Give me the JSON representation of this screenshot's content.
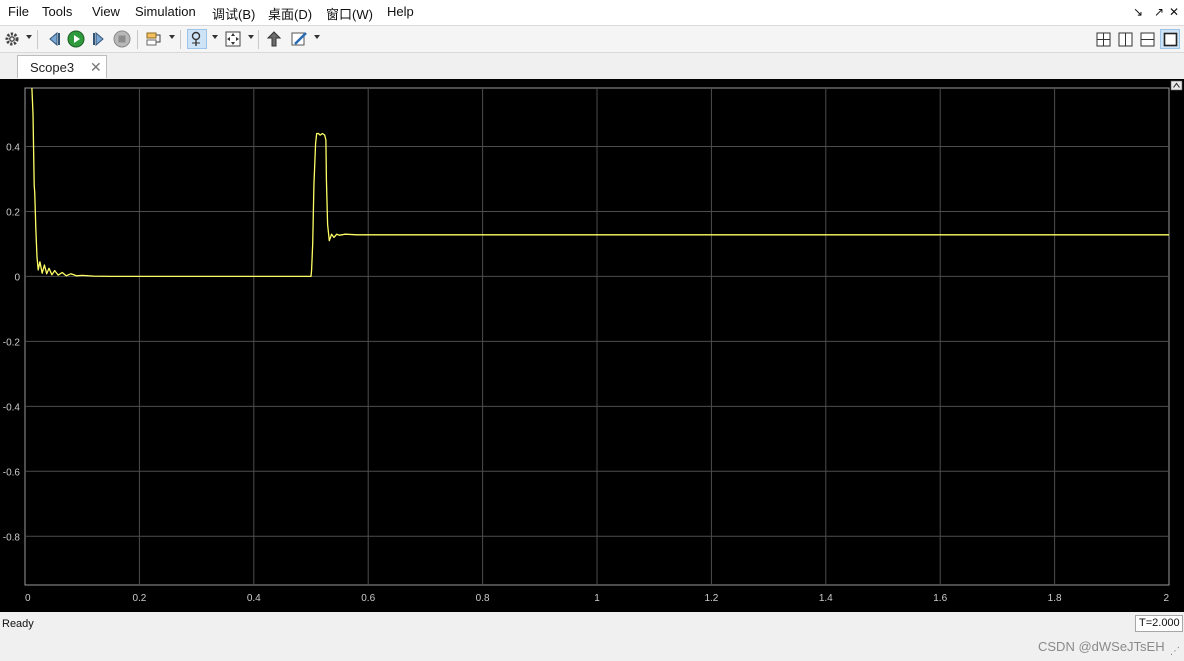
{
  "menubar": {
    "items": [
      "File",
      "Tools",
      "View",
      "Simulation",
      "调试(B)",
      "桌面(D)",
      "窗口(W)",
      "Help"
    ],
    "window_buttons": [
      "↘",
      "↗",
      "✕"
    ]
  },
  "toolbar": {
    "left_icons": [
      "gear-icon",
      "step-back-icon",
      "run-icon",
      "step-forward-icon",
      "stop-icon",
      "signal-select-icon",
      "zoom-icon",
      "autoscale-icon",
      "highlight-block-icon",
      "style-icon"
    ],
    "right_icons": [
      "layout-2x2-icon",
      "layout-2col-icon",
      "layout-2row-icon",
      "layout-single-icon"
    ]
  },
  "tab": {
    "label": "Scope3",
    "close": "✕"
  },
  "status": {
    "text": "Ready",
    "time": "T=2.000"
  },
  "watermark": "CSDN @dWSeJTsEH",
  "colors": {
    "background": "#000000",
    "grid": "#4d4d4d",
    "trace": "#ffff66",
    "tick_text": "#cccccc"
  },
  "chart_data": {
    "type": "line",
    "title": "",
    "xlabel": "",
    "ylabel": "",
    "xlim": [
      0,
      2
    ],
    "ylim": [
      -0.95,
      0.58
    ],
    "xticks": [
      0,
      0.2,
      0.4,
      0.6,
      0.8,
      1,
      1.2,
      1.4,
      1.6,
      1.8,
      2
    ],
    "xtick_labels": [
      "0",
      "0.2",
      "0.4",
      "0.6",
      "0.8",
      "1",
      "1.2",
      "1.4",
      "1.6",
      "1.8",
      "2"
    ],
    "yticks": [
      0.4,
      0.2,
      0,
      -0.2,
      -0.4,
      -0.6,
      -0.8
    ],
    "ytick_labels": [
      "0.4",
      "0.2",
      "0",
      "-0.2",
      "-0.4",
      "-0.6",
      "-0.8"
    ],
    "grid": true,
    "series": [
      {
        "x": [
          0.012,
          0.014,
          0.016,
          0.017,
          0.019,
          0.021,
          0.023,
          0.026,
          0.03,
          0.034,
          0.038,
          0.042,
          0.047,
          0.052,
          0.058,
          0.065,
          0.072,
          0.08,
          0.09,
          0.1,
          0.12,
          0.15,
          0.2,
          0.3,
          0.4,
          0.48,
          0.5,
          0.501,
          0.503,
          0.505,
          0.508,
          0.51,
          0.513,
          0.516,
          0.52,
          0.524,
          0.526,
          0.527,
          0.529,
          0.532,
          0.536,
          0.54,
          0.545,
          0.55,
          0.56,
          0.58,
          0.6,
          0.7,
          0.8,
          0.9,
          1.0,
          1.2,
          1.4,
          1.6,
          1.8,
          2.0
        ],
        "y": [
          0.58,
          0.5,
          0.28,
          0.26,
          0.14,
          0.06,
          0.02,
          0.045,
          0.01,
          0.035,
          0.008,
          0.025,
          0.005,
          0.018,
          0.004,
          0.012,
          0.002,
          0.008,
          0.002,
          0.003,
          0.001,
          0.0,
          0.0,
          0.0,
          0.0,
          0.0,
          0.0,
          0.02,
          0.1,
          0.28,
          0.41,
          0.44,
          0.44,
          0.435,
          0.44,
          0.435,
          0.42,
          0.3,
          0.16,
          0.11,
          0.13,
          0.12,
          0.13,
          0.127,
          0.13,
          0.128,
          0.128,
          0.128,
          0.128,
          0.128,
          0.128,
          0.128,
          0.128,
          0.128,
          0.128,
          0.128
        ]
      }
    ]
  }
}
